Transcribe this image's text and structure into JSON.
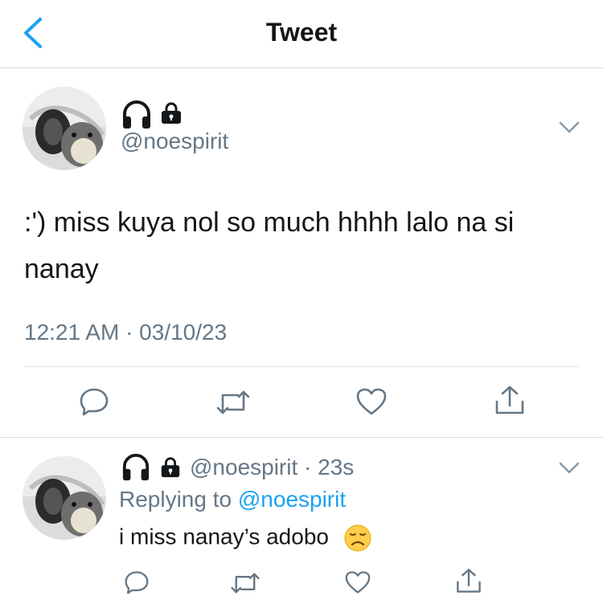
{
  "header": {
    "title": "Tweet"
  },
  "main_tweet": {
    "handle": "@noespirit",
    "text": ":') miss kuya nol so much hhhh lalo na si nanay",
    "timestamp": "12:21 AM · 03/10/23"
  },
  "reply": {
    "handle": "@noespirit",
    "time": "· 23s",
    "replying_prefix": "Replying to",
    "replying_handle": "@noespirit",
    "text": "i miss nanay’s adobo"
  },
  "icons": {
    "back": "chevron-left-icon",
    "headphones": "headphones-icon",
    "lock": "lock-icon",
    "more": "chevron-down-icon",
    "reply": "comment-icon",
    "retweet": "retweet-icon",
    "like": "heart-icon",
    "share": "share-icon",
    "emoji": "disappointed-face-emoji"
  },
  "colors": {
    "accent": "#1da1f2",
    "secondary_text": "#657786",
    "divider": "#e1e8ed"
  }
}
